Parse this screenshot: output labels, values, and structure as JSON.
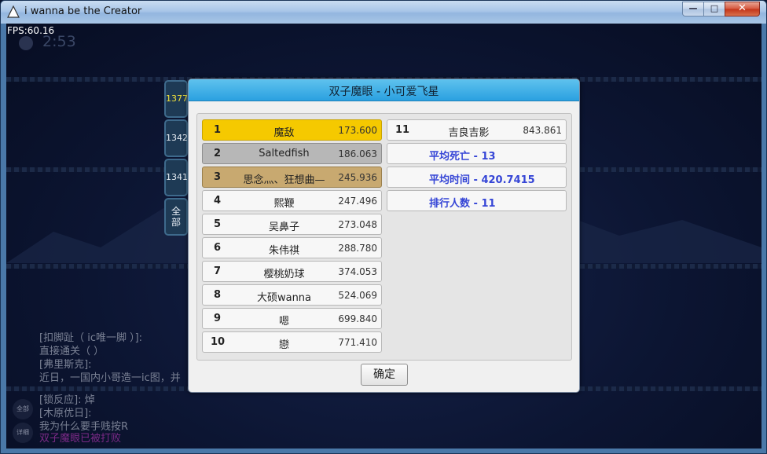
{
  "window": {
    "title": "i wanna be the Creator",
    "minimize_glyph": "—",
    "maximize_glyph": "□",
    "close_glyph": "✕"
  },
  "hud": {
    "fps": "FPS:60.16",
    "timer": "2:53"
  },
  "chat": {
    "lines": [
      "[扣脚趾（ ic唯一脚 ）]:",
      "直接通关（ ）",
      "[弗里斯克]:",
      "近日，一国内小哥造一ic图，并",
      "[锁反应]: 焯",
      "[木原优日]:",
      "我为什么要手贱按R",
      "双子魔眼已被打败"
    ]
  },
  "round_buttons": {
    "all": "全部",
    "detail": "详细"
  },
  "side_tabs": [
    {
      "label": "1377",
      "active": true
    },
    {
      "label": "1342",
      "active": false
    },
    {
      "label": "1341",
      "active": false
    },
    {
      "label": "全部",
      "active": false
    }
  ],
  "dialog": {
    "title": "双子魔眼 - 小可爱飞星",
    "ok_label": "确定",
    "rankings": [
      {
        "rank": "1",
        "name": "魔敌",
        "time": "173.600"
      },
      {
        "rank": "2",
        "name": "Saltedfish",
        "time": "186.063"
      },
      {
        "rank": "3",
        "name": "思念灬、狂想曲—",
        "time": "245.936"
      },
      {
        "rank": "4",
        "name": "熙鞭",
        "time": "247.496"
      },
      {
        "rank": "5",
        "name": "吴鼻子",
        "time": "273.048"
      },
      {
        "rank": "6",
        "name": "朱伟祺",
        "time": "288.780"
      },
      {
        "rank": "7",
        "name": "樱桃奶球",
        "time": "374.053"
      },
      {
        "rank": "8",
        "name": "大硕wanna",
        "time": "524.069"
      },
      {
        "rank": "9",
        "name": "嗯",
        "time": "699.840"
      },
      {
        "rank": "10",
        "name": "戀",
        "time": "771.410"
      },
      {
        "rank": "11",
        "name": "吉良吉影",
        "time": "843.861"
      }
    ],
    "stats": {
      "avg_deaths": "平均死亡 - 13",
      "avg_time": "平均时间 - 420.7415",
      "player_count": "排行人数 - 11"
    }
  },
  "colors": {
    "gold": "#f5c900",
    "silver": "#b7b7b7",
    "bronze": "#c8a970",
    "stat_text": "#3545d6",
    "active_tab": "#f2e23a"
  }
}
